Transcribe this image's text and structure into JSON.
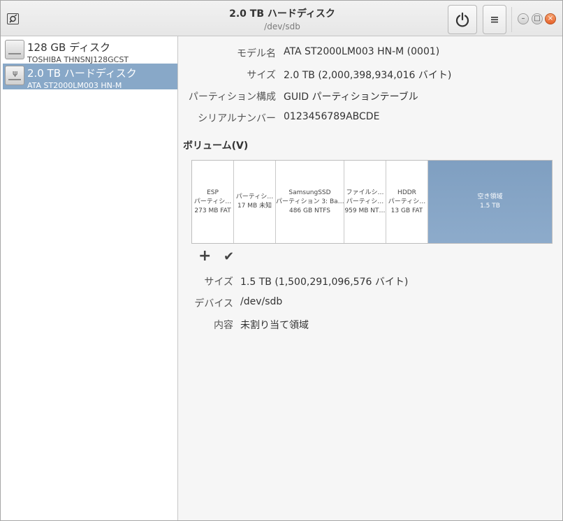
{
  "window": {
    "title": "2.0 TB ハードディスク",
    "subtitle": "/dev/sdb",
    "icons": {
      "app": "disks-app-icon",
      "power": "power-icon",
      "menu": "hamburger-menu-icon"
    },
    "controls": {
      "minimize": "–",
      "maximize": "□",
      "close": "×"
    }
  },
  "sidebar": {
    "drives": [
      {
        "name": "128 GB ディスク",
        "model": "TOSHIBA THNSNJ128GCST",
        "icon": "harddisk-icon",
        "selected": false
      },
      {
        "name": "2.0 TB ハードディスク",
        "model": "ATA ST2000LM003 HN-M",
        "icon": "usb-harddisk-icon",
        "selected": true
      }
    ]
  },
  "details": {
    "model_label": "モデル名",
    "model_value": "ATA ST2000LM003 HN-M (0001)",
    "size_label": "サイズ",
    "size_value": "2.0 TB (2,000,398,934,016 バイト)",
    "partitioning_label": "パーティション構成",
    "partitioning_value": "GUID パーティションテーブル",
    "serial_label": "シリアルナンバー",
    "serial_value": "0123456789ABCDE"
  },
  "volumes": {
    "title": "ボリューム(V)",
    "partitions": [
      {
        "line1": "ESP",
        "line2": "パーティシ…",
        "line3": "273 MB FAT"
      },
      {
        "line1": "パーティシ…",
        "line2": "17 MB 未知"
      },
      {
        "line1": "SamsungSSD",
        "line2": "パーティション 3: Ba…",
        "line3": "486 GB NTFS"
      },
      {
        "line1": "ファイルシ…",
        "line2": "パーティシ…",
        "line3": "959 MB NT…"
      },
      {
        "line1": "HDDR",
        "line2": "パーティシ…",
        "line3": "13 GB FAT"
      },
      {
        "line1": "空き領域",
        "line2": "1.5 TB"
      }
    ],
    "toolbar": {
      "add": "+",
      "apply": "✔"
    }
  },
  "selected_partition": {
    "size_label": "サイズ",
    "size_value": "1.5 TB (1,500,291,096,576 バイト)",
    "device_label": "デバイス",
    "device_value": "/dev/sdb",
    "contents_label": "内容",
    "contents_value": "未割り当て領域"
  }
}
